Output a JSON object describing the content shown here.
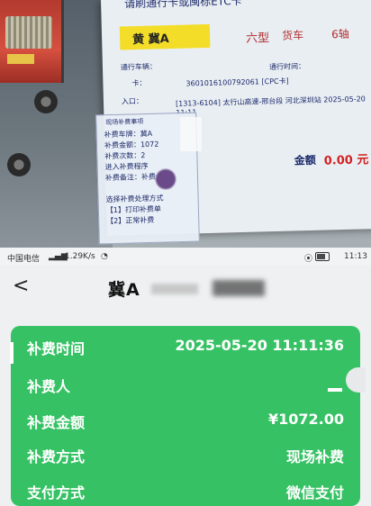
{
  "photo": {
    "monitor_title": "请刷通行卡或闽标ETC卡",
    "plate_text": "黄  冀A",
    "vehicle_type": "六型",
    "vehicle_kind": "货车",
    "axle": "6轴",
    "fields": {
      "entry_station_label": "通行车辆：",
      "time_label": "通行时间：",
      "card_label": "卡：",
      "card_value": "3601016100792061 [CPC卡]",
      "entry_label": "入口：",
      "entry_value": "[1313-6104] 太行山高速-邢台段 河北深圳站 2025-05-20 11:11"
    },
    "amount_label": "金额",
    "amount_value": "0.00 元",
    "popup": {
      "title": "现场补费事项",
      "lines": [
        "补费车牌：冀A",
        "补费金额：1072",
        "补费次数：2",
        "进入补费程序",
        "补费备注：补费",
        "选择补费处理方式",
        "【1】打印补费单",
        "【2】正常补费"
      ]
    }
  },
  "status_bar": {
    "carrier": "中国电信",
    "speed": "1.29K/s",
    "time": "11:13"
  },
  "nav": {
    "back_label": "<",
    "title": "冀A"
  },
  "card": {
    "rows": [
      {
        "label": "补费时间",
        "value": "2025-05-20 11:11:36"
      },
      {
        "label": "补费人",
        "value": ""
      },
      {
        "label": "补费金额",
        "value": "¥1072.00"
      },
      {
        "label": "补费方式",
        "value": "现场补费"
      },
      {
        "label": "支付方式",
        "value": "微信支付"
      }
    ]
  }
}
